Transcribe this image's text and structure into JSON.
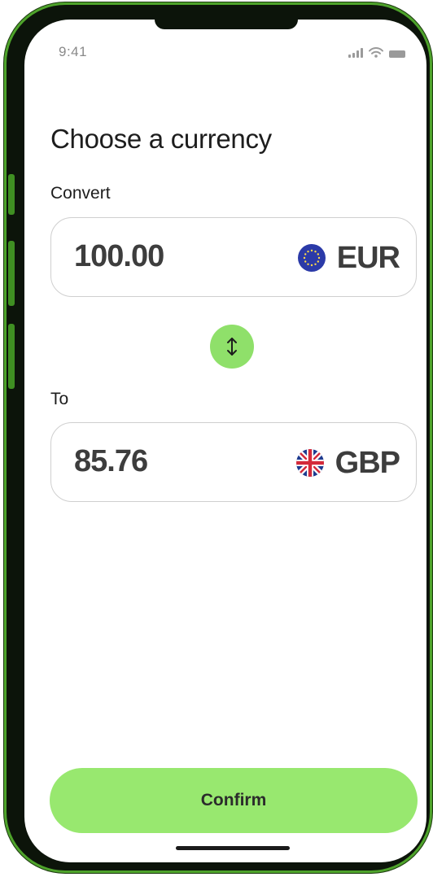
{
  "status_bar": {
    "time": "9:41",
    "icons": [
      "cellular-signal-icon",
      "wifi-icon",
      "battery-icon"
    ]
  },
  "page": {
    "title": "Choose a currency"
  },
  "convert": {
    "label": "Convert",
    "amount": "100.00",
    "currency_code": "EUR",
    "flag_icon": "eu-flag-icon"
  },
  "swap": {
    "icon": "swap-vertical-icon"
  },
  "to": {
    "label": "To",
    "amount": "85.76",
    "currency_code": "GBP",
    "flag_icon": "uk-flag-icon"
  },
  "actions": {
    "confirm_label": "Confirm"
  },
  "colors": {
    "accent": "#98e86f",
    "text": "#3d3d3d",
    "frame_green": "#4ea32b"
  }
}
